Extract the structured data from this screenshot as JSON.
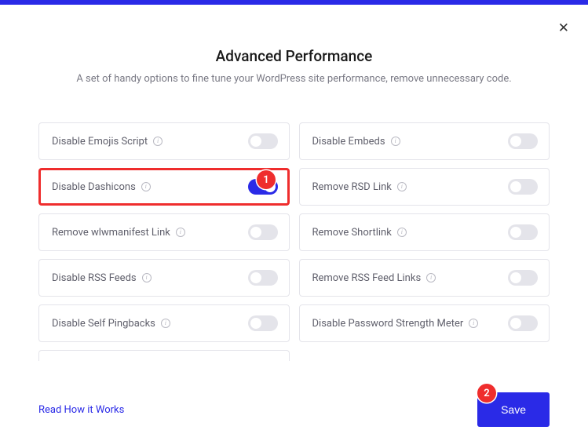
{
  "header": {
    "title": "Advanced Performance",
    "subtitle": "A set of handy options to fine tune your WordPress site performance, remove unnecessary code."
  },
  "options": {
    "emojis": {
      "label": "Disable Emojis Script",
      "on": false
    },
    "embeds": {
      "label": "Disable Embeds",
      "on": false
    },
    "dashicons": {
      "label": "Disable Dashicons",
      "on": true
    },
    "rsd": {
      "label": "Remove RSD Link",
      "on": false
    },
    "wlw": {
      "label": "Remove wlwmanifest Link",
      "on": false
    },
    "shortlink": {
      "label": "Remove Shortlink",
      "on": false
    },
    "rss": {
      "label": "Disable RSS Feeds",
      "on": false
    },
    "rsslinks": {
      "label": "Remove RSS Feed Links",
      "on": false
    },
    "pingbacks": {
      "label": "Disable Self Pingbacks",
      "on": false
    },
    "pwdmeter": {
      "label": "Disable Password Strength Meter",
      "on": false
    }
  },
  "annotations": {
    "badge1": "1",
    "badge2": "2"
  },
  "footer": {
    "how_link": "Read How it Works",
    "save": "Save"
  }
}
